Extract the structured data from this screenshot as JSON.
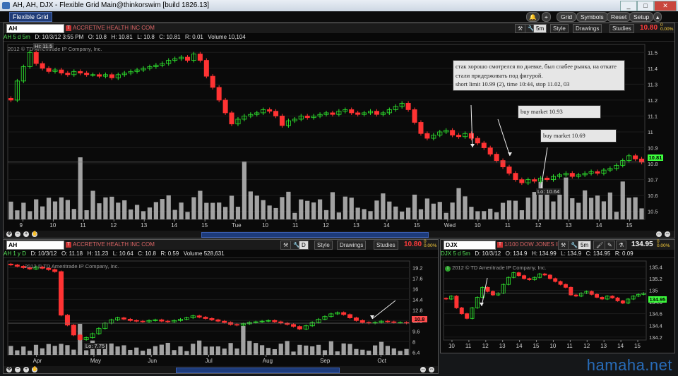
{
  "window": {
    "title": "AH, AH, DJX - Flexible Grid Main@thinkorswim [build 1826.13]",
    "min": "_",
    "max": "□",
    "close": "✕"
  },
  "toolbar": {
    "tab": "Flexible Grid",
    "buttons": [
      "Grid",
      "Symbols",
      "Reset",
      "Setup"
    ]
  },
  "panel_main": {
    "symbol": "AH",
    "company": "ACCRETIVE HEALTH INC COM",
    "info": [
      "AH 5 d 5m",
      "D: 10/3/12 3:55 PM",
      "O: 10.8",
      "H: 10.81",
      "L: 10.8",
      "C: 10.81",
      "R: 0.01",
      "Volume  10,104"
    ],
    "timeframe": "5m",
    "style": "Style",
    "drawings": "Drawings",
    "studies": "Studies",
    "last": "10.80",
    "chg1": "0",
    "chg2": "0.00%",
    "copyright": "2012 © TD Ameritrade IP Company, Inc.",
    "hi_label": "Hi: 11.5",
    "lo_label": "Lo: 10.64",
    "price_box": "10.81",
    "notes": [
      "стак хорошо смотрелся по дневке, был слабее рынка, на откате стали придерживать под фигурой.",
      "short limit 10.99 (2), time 10:44, stop 11.02, 03"
    ],
    "buy1": "buy market 10.93",
    "buy2": "buy market 10.69"
  },
  "panel_left": {
    "symbol": "AH",
    "company": "ACCRETIVE HEALTH INC COM",
    "info": [
      "AH 1 y D",
      "D: 10/3/12",
      "O: 11.18",
      "H: 11.23",
      "L: 10.64",
      "C: 10.8",
      "R: 0.59",
      "Volume  528,631"
    ],
    "timeframe": "D",
    "style": "Style",
    "drawings": "Drawings",
    "studies": "Studies",
    "last": "10.80",
    "chg1": "0",
    "chg2": "0.00%",
    "copyright": "2012 © TD Ameritrade IP Company, Inc.",
    "lo_label": "Lo: 7.75",
    "price_box": "10.8"
  },
  "panel_right": {
    "symbol": "DJX",
    "company": "1/100 DOW JONES IND",
    "info": [
      "DJX 5 d 5m",
      "D: 10/3/12",
      "O: 134.9",
      "H: 134.99",
      "L: 134.9",
      "C: 134.95",
      "R: 0.09"
    ],
    "timeframe": "5m",
    "last": "134.95",
    "chg1": "0",
    "chg2": "0.00%",
    "copyright": "2012 © TD Ameritrade IP Company, Inc.",
    "price_box": "134.95"
  },
  "watermark": "hamaha.net",
  "chart_data": [
    {
      "type": "candlestick",
      "title": "AH 5 d 5m",
      "x_ticks": [
        "9",
        "10",
        "11",
        "12",
        "13",
        "14",
        "15",
        "Tue",
        "10",
        "11",
        "12",
        "13",
        "14",
        "15",
        "Wed",
        "10",
        "11",
        "12",
        "13",
        "14",
        "15"
      ],
      "y_ticks": [
        11.5,
        11.4,
        11.3,
        11.2,
        11.1,
        11,
        10.9,
        10.8,
        10.7,
        10.6,
        10.5
      ],
      "ylim": [
        10.45,
        11.55
      ],
      "close": [
        11.2,
        11.32,
        11.41,
        11.5,
        11.43,
        11.4,
        11.38,
        11.39,
        11.37,
        11.36,
        11.38,
        11.37,
        11.36,
        11.36,
        11.35,
        11.36,
        11.34,
        11.36,
        11.37,
        11.38,
        11.39,
        11.4,
        11.41,
        11.42,
        11.43,
        11.45,
        11.46,
        11.47,
        11.45,
        11.49,
        11.45,
        11.35,
        11.28,
        11.2,
        11.12,
        11.05,
        11.08,
        11.1,
        11.11,
        11.12,
        11.14,
        11.13,
        11.1,
        11.04,
        11.07,
        11.08,
        11.1,
        11.09,
        11.1,
        11.11,
        11.12,
        11.11,
        11.13,
        11.14,
        11.12,
        11.11,
        11.12,
        11.13,
        11.11,
        11.12,
        11.14,
        11.16,
        11.18,
        11.14,
        11.06,
        10.99,
        10.96,
        10.98,
        11.0,
        11.01,
        10.98,
        10.97,
        10.99,
        10.96,
        10.93,
        10.9,
        10.86,
        10.82,
        10.78,
        10.74,
        10.7,
        10.68,
        10.7,
        10.69,
        10.71,
        10.7,
        10.72,
        10.73,
        10.74,
        10.72,
        10.73,
        10.74,
        10.75,
        10.74,
        10.76,
        10.77,
        10.79,
        10.82,
        10.85,
        10.83,
        10.81
      ],
      "annotations": [
        "Hi: 11.5",
        "Lo: 10.64"
      ]
    },
    {
      "type": "candlestick",
      "title": "AH 1 y D",
      "x_ticks": [
        "Apr",
        "May",
        "Jun",
        "Jul",
        "Aug",
        "Sep",
        "Oct"
      ],
      "y_ticks": [
        19.2,
        17.6,
        16,
        14.4,
        12.8,
        11.2,
        9.6,
        8,
        6.4
      ],
      "ylim": [
        6.0,
        20.2
      ],
      "close": [
        19.6,
        19.4,
        19.2,
        19.0,
        19.3,
        19.1,
        18.9,
        18.6,
        12.0,
        10.5,
        9.0,
        8.3,
        8.6,
        9.2,
        10.0,
        10.8,
        11.3,
        11.6,
        11.4,
        11.2,
        11.1,
        11.0,
        11.2,
        11.3,
        11.1,
        11.0,
        11.2,
        11.4,
        11.6,
        11.9,
        11.7,
        11.5,
        11.3,
        11.1,
        10.9,
        10.6,
        10.5,
        10.7,
        10.9,
        11.0,
        11.1,
        11.2,
        11.0,
        10.8,
        10.6,
        10.3,
        9.9,
        10.4,
        10.9,
        11.4,
        11.8,
        12.2,
        12.4,
        12.1,
        11.6,
        11.2,
        10.9,
        10.8,
        10.9,
        11.1,
        11.0,
        10.9,
        10.9,
        10.8
      ],
      "annotations": [
        "Lo: 7.75"
      ]
    },
    {
      "type": "candlestick",
      "title": "DJX 5 d 5m",
      "x_ticks": [
        "10",
        "11",
        "12",
        "13",
        "14",
        "15",
        "10",
        "11",
        "12",
        "13",
        "14",
        "15"
      ],
      "y_ticks": [
        135.4,
        135.2,
        135,
        134.8,
        134.6,
        134.4,
        134.2
      ],
      "ylim": [
        134.15,
        135.5
      ],
      "close": [
        134.85,
        134.9,
        134.7,
        134.6,
        134.52,
        134.7,
        134.88,
        135.05,
        134.98,
        134.92,
        134.95,
        135.1,
        135.22,
        135.3,
        135.25,
        135.2,
        135.18,
        135.22,
        135.28,
        135.26,
        135.2,
        135.15,
        135.1,
        135.05,
        134.92,
        134.9,
        134.95,
        134.98,
        134.93,
        134.88,
        134.85,
        134.9,
        134.87,
        134.82,
        134.78,
        134.85,
        134.9,
        134.93,
        134.95
      ]
    }
  ]
}
